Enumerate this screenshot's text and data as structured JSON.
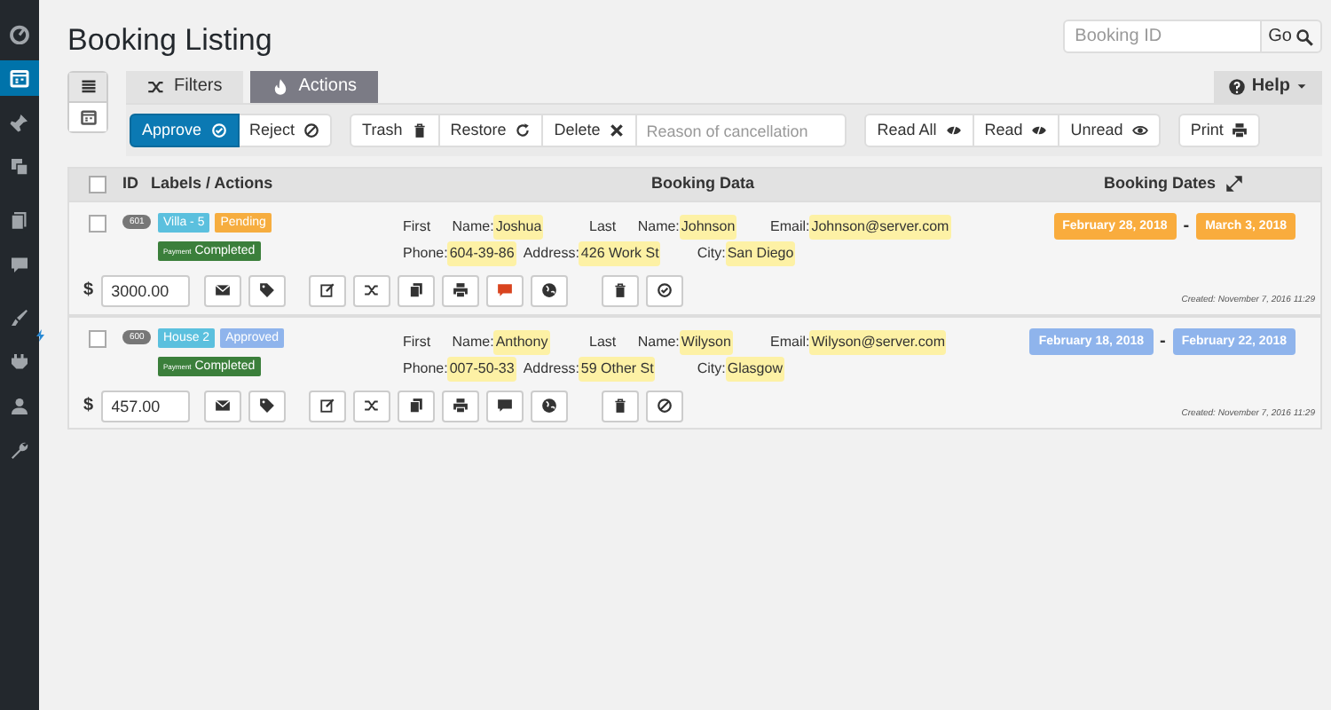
{
  "sidebar": {
    "items": [
      {
        "kind": "dashboard",
        "selected": false
      },
      {
        "kind": "calendar",
        "selected": true
      },
      {
        "kind": "pin",
        "selected": false
      },
      {
        "kind": "media",
        "selected": false
      },
      {
        "kind": "pages",
        "selected": false
      },
      {
        "kind": "comments",
        "selected": false
      },
      {
        "kind": "brush",
        "selected": false
      },
      {
        "kind": "plug",
        "selected": false
      },
      {
        "kind": "user",
        "selected": false
      },
      {
        "kind": "wrench",
        "selected": false
      }
    ]
  },
  "title": "Booking Listing",
  "search": {
    "placeholder": "Booking ID",
    "button": "Go"
  },
  "views": [
    {
      "kind": "list",
      "selected": true
    },
    {
      "kind": "calendar",
      "selected": false
    }
  ],
  "tabs": [
    {
      "label": "Filters",
      "kind": "shuffle",
      "selected": false
    },
    {
      "label": "Actions",
      "kind": "fire",
      "selected": true
    }
  ],
  "help": {
    "label": "Help"
  },
  "toolbar": {
    "groups": [
      [
        {
          "label": "Approve",
          "kind": "check",
          "selected": true
        },
        {
          "label": "Reject",
          "kind": "ban",
          "selected": false
        }
      ],
      [
        {
          "label": "Trash",
          "kind": "trash",
          "selected": false
        },
        {
          "label": "Restore",
          "kind": "refresh",
          "selected": false
        },
        {
          "label": "Delete",
          "kind": "x",
          "selected": false
        }
      ],
      [
        {
          "label": "Read All",
          "kind": "eyeslash",
          "selected": false
        },
        {
          "label": "Read",
          "kind": "eyeslash",
          "selected": false
        },
        {
          "label": "Unread",
          "kind": "eye",
          "selected": false
        }
      ],
      [
        {
          "label": "Print",
          "kind": "print",
          "selected": false
        }
      ]
    ],
    "reason_placeholder": "Reason of cancellation"
  },
  "table": {
    "select_all": {
      "checked": false
    },
    "columns": [
      "ID",
      "Labels / Actions",
      "Booking Data",
      "Booking Dates"
    ],
    "rows": [
      {
        "id": "601",
        "checked": false,
        "new": false,
        "labels": [
          {
            "text": "Villa - 5",
            "color": "#5bc0de"
          },
          {
            "text": "Pending",
            "color": "#f6ad3f"
          }
        ],
        "payment": {
          "small": "Payment",
          "text": "Completed"
        },
        "fields": [
          [
            {
              "label": "First Name:",
              "value": "Joshua"
            },
            {
              "label": "Last Name:",
              "value": "Johnson"
            },
            {
              "label": "Email:",
              "value": "Johnson@server.com"
            }
          ],
          [
            {
              "label": "Phone:",
              "value": "604-39-86"
            },
            {
              "label": "Address:",
              "value": "426 Work St"
            },
            {
              "label": "City:",
              "value": "San Diego"
            }
          ]
        ],
        "dates": [
          {
            "text": "February 28, 2018",
            "color": "#f9ac3d"
          },
          {
            "text": "March 3, 2018",
            "color": "#f9ac3d"
          }
        ],
        "dash": "-",
        "currency": "$",
        "cost": "3000.00",
        "actions": [
          {
            "kind": "mail",
            "highlighted": false
          },
          {
            "kind": "tag",
            "highlighted": false
          },
          {
            "kind": "edit",
            "highlighted": false
          },
          {
            "kind": "shuffle",
            "highlighted": false
          },
          {
            "kind": "copy",
            "highlighted": false
          },
          {
            "kind": "print",
            "highlighted": false
          },
          {
            "kind": "note",
            "highlighted": true
          },
          {
            "kind": "globe",
            "highlighted": false
          },
          {
            "kind": "trash",
            "highlighted": false
          },
          {
            "kind": "check",
            "highlighted": false
          }
        ],
        "created": "Created: November 7, 2016 11:29"
      },
      {
        "id": "600",
        "checked": false,
        "new": true,
        "labels": [
          {
            "text": "House 2",
            "color": "#5bc0de"
          },
          {
            "text": "Approved",
            "color": "#8fb4ec"
          }
        ],
        "payment": {
          "small": "Payment",
          "text": "Completed"
        },
        "fields": [
          [
            {
              "label": "First Name:",
              "value": "Anthony"
            },
            {
              "label": "Last Name:",
              "value": "Wilyson"
            },
            {
              "label": "Email:",
              "value": "Wilyson@server.com"
            }
          ],
          [
            {
              "label": "Phone:",
              "value": "007-50-33"
            },
            {
              "label": "Address:",
              "value": "59 Other St"
            },
            {
              "label": "City:",
              "value": "Glasgow"
            }
          ]
        ],
        "dates": [
          {
            "text": "February 18, 2018",
            "color": "#8fb4ec"
          },
          {
            "text": "February 22, 2018",
            "color": "#8fb4ec"
          }
        ],
        "dash": "-",
        "currency": "$",
        "cost": "457.00",
        "actions": [
          {
            "kind": "mail",
            "highlighted": false
          },
          {
            "kind": "tag",
            "highlighted": false
          },
          {
            "kind": "edit",
            "highlighted": false
          },
          {
            "kind": "shuffle",
            "highlighted": false
          },
          {
            "kind": "copy",
            "highlighted": false
          },
          {
            "kind": "print",
            "highlighted": false
          },
          {
            "kind": "note",
            "highlighted": false
          },
          {
            "kind": "globe",
            "highlighted": false
          },
          {
            "kind": "trash",
            "highlighted": false
          },
          {
            "kind": "ban",
            "highlighted": false
          }
        ],
        "created": "Created: November 7, 2016 11:29"
      }
    ]
  }
}
